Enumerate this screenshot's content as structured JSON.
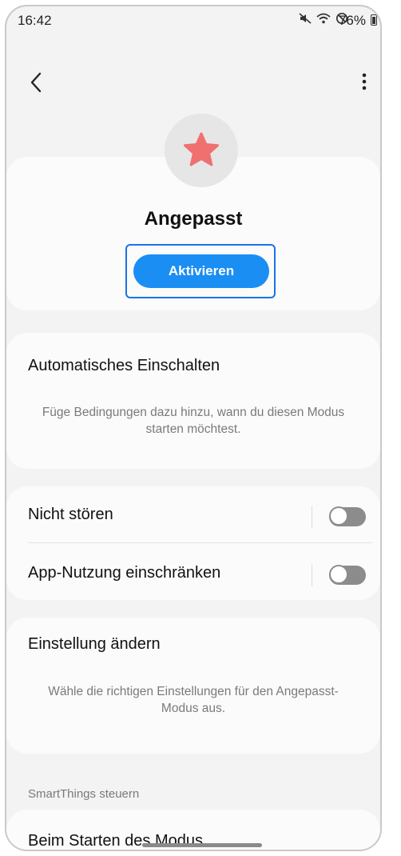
{
  "status_bar": {
    "time": "16:42",
    "battery": "76%",
    "icons": [
      "mute-icon",
      "wifi-icon",
      "do-not-disturb-icon",
      "battery-icon"
    ]
  },
  "header": {
    "back_icon": "back-arrow-icon",
    "more_icon": "more-vertical-icon"
  },
  "mode": {
    "icon": "star-icon",
    "icon_color": "#f07070",
    "title": "Angepasst",
    "activate_label": "Aktivieren",
    "accent": "#1a8ef3"
  },
  "auto_on": {
    "heading": "Automatisches Einschalten",
    "description": "Füge Bedingungen dazu hinzu, wann du diesen Modus starten möchtest."
  },
  "toggles": [
    {
      "label": "Nicht stören",
      "on": false
    },
    {
      "label": "App-Nutzung einschränken",
      "on": false
    }
  ],
  "settings_change": {
    "heading": "Einstellung ändern",
    "description": "Wähle die richtigen Einstellungen für den Angepasst-Modus aus."
  },
  "smartthings": {
    "section_label": "SmartThings steuern",
    "item_label": "Beim Starten des Modus"
  }
}
